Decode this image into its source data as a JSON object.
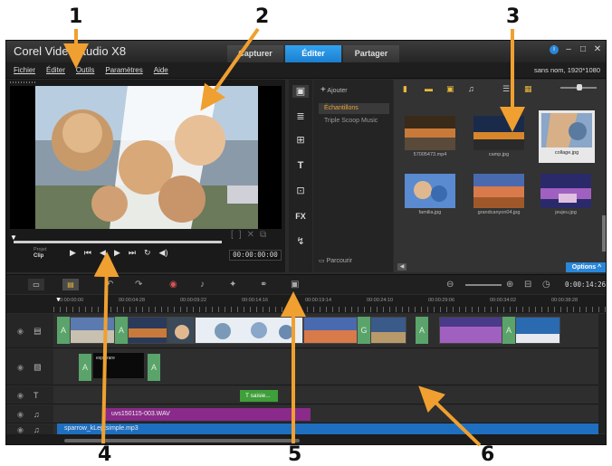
{
  "callouts": [
    "1",
    "2",
    "3",
    "4",
    "5",
    "6"
  ],
  "window": {
    "title": "Corel VideoStudio X8",
    "tabs": [
      {
        "label": "Capturer",
        "active": false
      },
      {
        "label": "Éditer",
        "active": true
      },
      {
        "label": "Partager",
        "active": false
      }
    ],
    "controls": {
      "help": "i",
      "minimize": "–",
      "maximize": "□",
      "close": "✕"
    }
  },
  "menubar": {
    "items": [
      "Fichier",
      "Éditer",
      "Outils",
      "Paramètres",
      "Aide"
    ],
    "project_info": "sans nom, 1920*1080"
  },
  "player": {
    "mode_project": "Projet",
    "mode_clip": "Clip",
    "timecode": "00:00:00:00",
    "controls": [
      "play",
      "go-to-start",
      "previous-frame",
      "next-frame",
      "go-to-end",
      "repeat",
      "volume"
    ]
  },
  "library": {
    "add_label": "Ajouter",
    "folders": [
      {
        "label": "Échantillons",
        "selected": true
      },
      {
        "label": "Triple Scoop Music",
        "selected": false
      }
    ],
    "browse_label": "Parcourir",
    "options_label": "Options",
    "media": [
      {
        "name": "57005473.mp4",
        "selected": false,
        "colors": [
          "#3a2a1a",
          "#c97a3a",
          "#5a4a3a"
        ]
      },
      {
        "name": "camp.jpg",
        "selected": false,
        "colors": [
          "#1a2a4a",
          "#d8862a",
          "#2a2a2a"
        ]
      },
      {
        "name": "collage.jpg",
        "selected": true,
        "colors": [
          "#8aa6c8",
          "#d8b088",
          "#5a7aa0"
        ]
      },
      {
        "name": "familia.jpg",
        "selected": false,
        "colors": [
          "#5a8ad0",
          "#e0b890",
          "#3a6ab0"
        ]
      },
      {
        "name": "grandcanyon04.jpg",
        "selected": false,
        "colors": [
          "#4a6ab0",
          "#d87a4a",
          "#a0582a"
        ]
      },
      {
        "name": "jeujeu.jpg",
        "selected": false,
        "colors": [
          "#2a2a6a",
          "#a060c0",
          "#e0c0e0"
        ]
      }
    ]
  },
  "timeline": {
    "timecode": "0:00:14:26",
    "ruler": [
      "00:00:00:00",
      "00:00:04:28",
      "00:00:09:22",
      "00:00:14:16",
      "00:00:19:14",
      "00:00:24:10",
      "00:00:29:06",
      "00:00:34:02",
      "00:00:38:28"
    ],
    "text_clip": "T saisie...",
    "title_clip": "explorare",
    "voice_clip": "uvs150115-003.WAV",
    "music_clip": "sparrow_kLeptsimple.mp3",
    "accent": "#2a86d8",
    "track_icons": [
      "video-track-icon",
      "overlay-track-icon",
      "title-track-icon",
      "voice-track-icon",
      "music-track-icon"
    ]
  }
}
